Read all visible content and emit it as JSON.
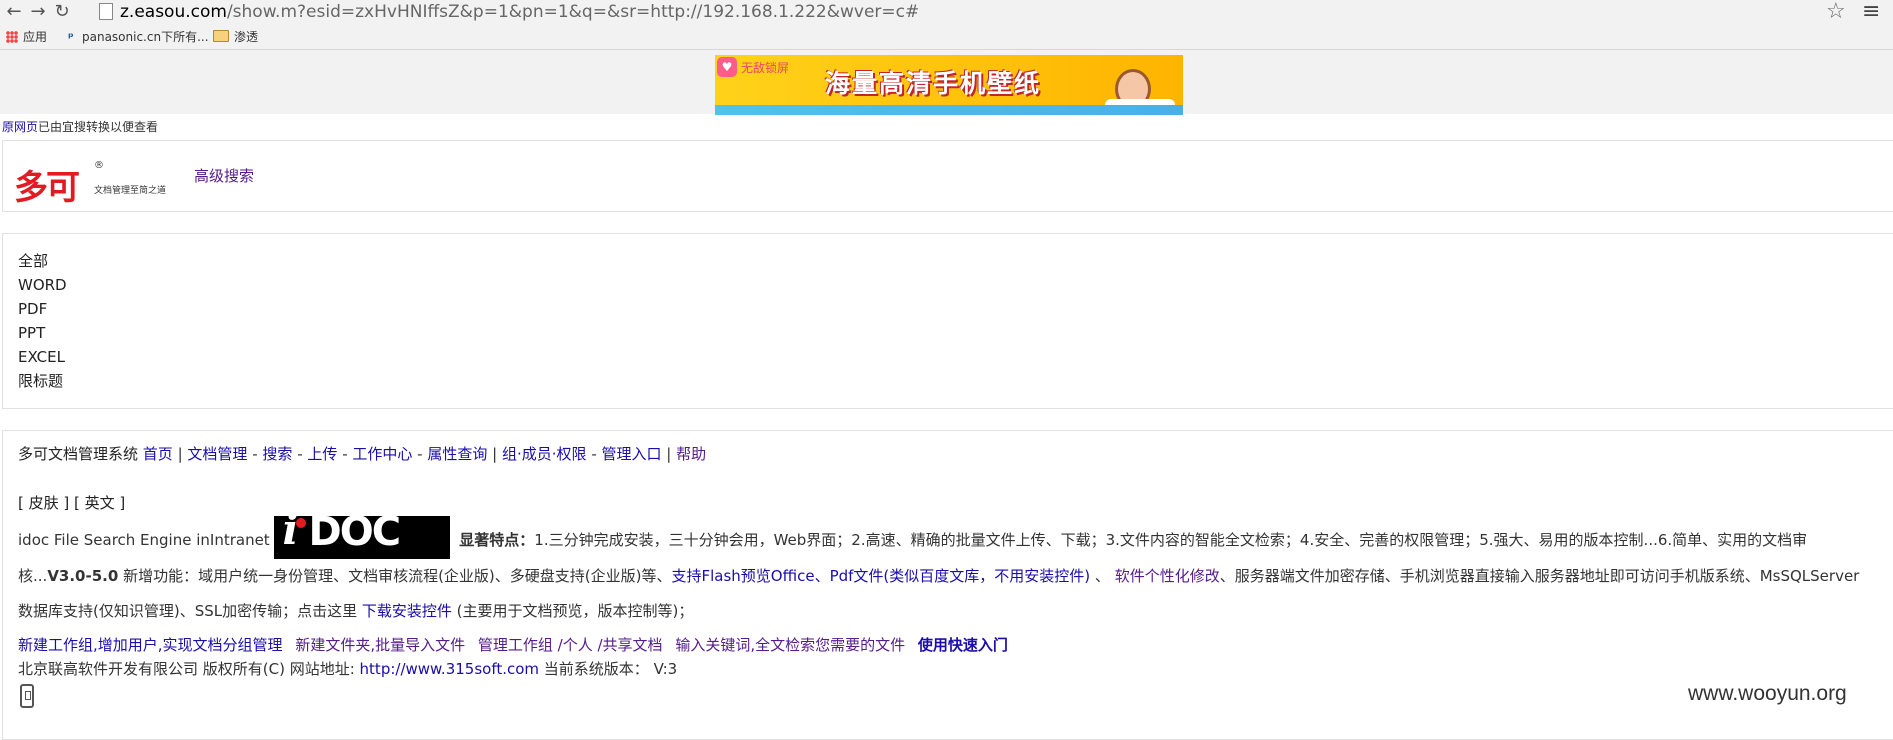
{
  "browser": {
    "url_host": "z.easou.com",
    "url_rest": "/show.m?esid=zxHvHNIffsZ&p=1&pn=1&q=&sr=http://192.168.1.222&wver=c#",
    "bookmarks": [
      "应用",
      "panasonic.cn下所有...",
      "渗透"
    ]
  },
  "banner": {
    "badge_text": "无敌锁屏",
    "title": "海量高清手机壁纸"
  },
  "notice": {
    "link": "原网页",
    "text": "已由宜搜转换以便查看"
  },
  "header": {
    "logo_text": "多可",
    "logo_reg": "®",
    "logo_tagline": "文档管理至简之道",
    "advanced_search": "高级搜索"
  },
  "filters": [
    "全部",
    "WORD",
    "PDF",
    "PPT",
    "EXCEL",
    "限标题"
  ],
  "nav": {
    "prefix": "多可文档管理系统",
    "home": "首页",
    "doc_manage": "文档管理",
    "search": "搜索",
    "upload": "上传",
    "work_center": "工作中心",
    "attr_query": "属性查询",
    "group_member": "组·成员·权限",
    "admin": "管理入口",
    "help": "帮助"
  },
  "skin_line": "[ 皮肤 ] [ 英文 ]",
  "intro": {
    "engine": "idoc File Search Engine inIntranet",
    "features_label": "显著特点：",
    "features_text": "1.三分钟完成安装，三十分钟会用，Web界面；2.高速、精确的批量文件上传、下载；3.文件内容的智能全文检索；4.安全、完善的权限管理；5.强大、易用的版本控制...6.简单、实用的文档审核...",
    "version": "V3.0-5.0",
    "new_features": " 新增功能：域用户统一身份管理、文档审核流程(企业版)、多硬盘支持(企业版)等、",
    "flash_link": "支持Flash预览Office、Pdf文件(类似百度文库，不用安装控件)",
    "sep": " 、 ",
    "custom_link": "软件个性化修改",
    "rest": "、服务器端文件加密存储、手机浏览器直接输入服务器地址即可访问手机版系统、MsSQLServer数据库支持(仅知识管理)、SSL加密传输；点击这里 ",
    "download_link": "下载安装控件",
    "download_note": " (主要用于文档预览，版本控制等)；"
  },
  "quick_links": {
    "l1": "新建工作组,增加用户,实现文档分组管理",
    "l2": "新建文件夹,批量导入文件",
    "l3": "管理工作组 /个人 /共享文档",
    "l4": "输入关键词,全文检索您需要的文件",
    "l5": "使用快速入门"
  },
  "footer": {
    "company": "北京联高软件开发有限公司 版权所有(C) 网站地址: ",
    "site": "http://www.315soft.com",
    "version_label": " 当前系统版本：  V:3"
  },
  "watermark": "www.wooyun.org"
}
